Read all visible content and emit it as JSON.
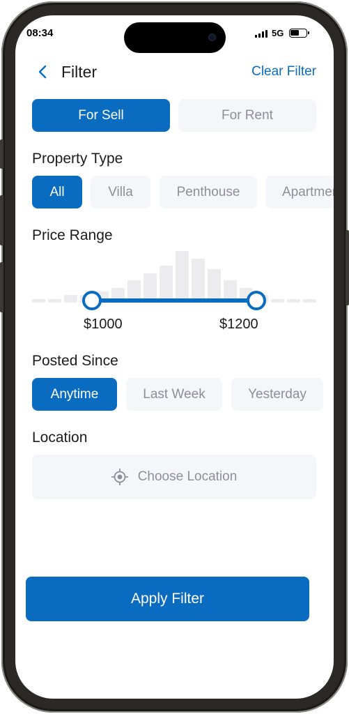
{
  "status_bar": {
    "time": "08:34",
    "network": "5G"
  },
  "header": {
    "title": "Filter",
    "clear_label": "Clear Filter"
  },
  "listing_type": {
    "options": [
      "For Sell",
      "For Rent"
    ],
    "selected": "For Sell"
  },
  "property_type": {
    "label": "Property Type",
    "options": [
      "All",
      "Villa",
      "Penthouse",
      "Apartment"
    ],
    "selected": "All"
  },
  "price_range": {
    "label": "Price Range",
    "min_label": "$1000",
    "max_label": "$1200",
    "histogram": [
      1,
      1,
      2,
      2,
      3,
      4,
      6,
      8,
      10,
      14,
      12,
      9,
      6,
      4,
      2,
      1,
      1,
      1
    ]
  },
  "posted_since": {
    "label": "Posted Since",
    "options": [
      "Anytime",
      "Last Week",
      "Yesterday"
    ],
    "selected": "Anytime"
  },
  "location": {
    "label": "Location",
    "placeholder": "Choose Location"
  },
  "apply_label": "Apply Filter",
  "colors": {
    "accent": "#0a6cc1",
    "pill_bg": "#f5f6f9",
    "muted_text": "#8b9098",
    "histogram": "#ececee"
  }
}
